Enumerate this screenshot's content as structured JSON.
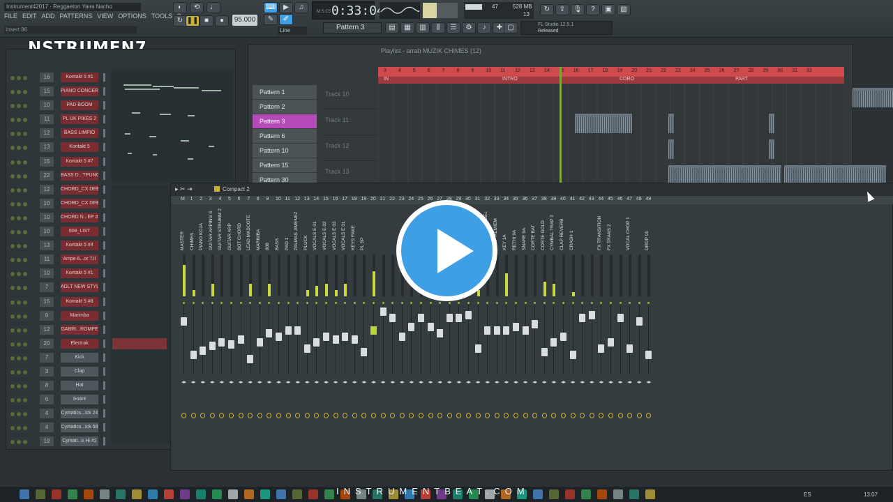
{
  "app": {
    "project_title": "Instrument42017 · Reggaeton Yaira Nacho",
    "menu": [
      "FILE",
      "EDIT",
      "ADD",
      "PATTERNS",
      "VIEW",
      "OPTIONS",
      "TOOLS",
      "?"
    ],
    "hint": "Insert 86",
    "tempo": "95.000",
    "time": "0:33:04",
    "time_unit": "M:S:CS",
    "cpu_poly": "47",
    "ram": "528 MB",
    "voices": "13",
    "pattern": "Pattern 3",
    "snap": "Line",
    "news_title": "FL Studio 12.5.1",
    "news_text": "Released"
  },
  "logo": "NSTRUMEN7",
  "rack": {
    "channels": [
      {
        "num": "16",
        "name": "Kontakt 5 #1",
        "style": "red"
      },
      {
        "num": "15",
        "name": "PIANO CONCERT",
        "style": "red"
      },
      {
        "num": "10",
        "name": "PAD BOOM",
        "style": "red"
      },
      {
        "num": "11",
        "name": "PL UK PIKES 2",
        "style": "red"
      },
      {
        "num": "12",
        "name": "BASS LIMPIO",
        "style": "red"
      },
      {
        "num": "13",
        "name": "Kontakt 5",
        "style": "red"
      },
      {
        "num": "15",
        "name": "Kontakt 5 #7",
        "style": "red"
      },
      {
        "num": "22",
        "name": "BASS D...TPUNO",
        "style": "red"
      },
      {
        "num": "12",
        "name": "CHORD_CX DEEP",
        "style": "red"
      },
      {
        "num": "10",
        "name": "CHORD_CX DEEP",
        "style": "red"
      },
      {
        "num": "10",
        "name": "CHORD N...EP #2",
        "style": "red"
      },
      {
        "num": "10",
        "name": "808_LIST",
        "style": "red"
      },
      {
        "num": "13",
        "name": "Kontakt 5 #4",
        "style": "red"
      },
      {
        "num": "11",
        "name": "Ampe 6...or T.II",
        "style": "red"
      },
      {
        "num": "10",
        "name": "Kontakt 5 #1",
        "style": "red"
      },
      {
        "num": "7",
        "name": "ADLT NEW STYLE",
        "style": "red"
      },
      {
        "num": "15",
        "name": "Kontakt 5 #6",
        "style": "red"
      },
      {
        "num": "9",
        "name": "Marimba",
        "style": "red"
      },
      {
        "num": "12",
        "name": "GABRI...ROMPE",
        "style": "red"
      },
      {
        "num": "20",
        "name": "Electrak",
        "style": "red"
      },
      {
        "num": "7",
        "name": "Kick",
        "style": "grey"
      },
      {
        "num": "3",
        "name": "Clap",
        "style": "grey"
      },
      {
        "num": "8",
        "name": "Hat",
        "style": "grey"
      },
      {
        "num": "6",
        "name": "Snare",
        "style": "grey"
      },
      {
        "num": "4",
        "name": "Cymatics...ick 24",
        "style": "grey"
      },
      {
        "num": "4",
        "name": "Cymatics...ick 58",
        "style": "grey"
      },
      {
        "num": "19",
        "name": "Cymati...k Hi #2",
        "style": "grey"
      }
    ]
  },
  "playlist": {
    "title": "Playlist - arrab MUZIK CHIMES (12)",
    "patterns": [
      "Pattern 1",
      "Pattern 2",
      "Pattern 3",
      "Pattern 6",
      "Pattern 10",
      "Pattern 15",
      "Pattern 30"
    ],
    "active_pattern": 2,
    "tracks": [
      "Track 10",
      "Track 11",
      "Track 12",
      "Track 13"
    ],
    "bar_numbers": [
      "3",
      "4",
      "5",
      "6",
      "7",
      "8",
      "9",
      "10",
      "11",
      "12",
      "13",
      "14",
      "15",
      "16",
      "17",
      "18",
      "19",
      "20",
      "21",
      "22",
      "23",
      "24",
      "25",
      "26",
      "27",
      "28",
      "29",
      "30",
      "31",
      "32"
    ],
    "markers": [
      "IN",
      "INTRO",
      "CORO",
      "PART"
    ]
  },
  "mixer": {
    "title": "Compact 2",
    "tracks": [
      {
        "name": "MASTER",
        "level": 0.75,
        "fader": 0.2
      },
      {
        "name": "CHIMES",
        "level": 0.15,
        "fader": 0.75
      },
      {
        "name": "PIANO KOJA",
        "level": 0.0,
        "fader": 0.68
      },
      {
        "name": "GUITAR ARPING S",
        "level": 0.3,
        "fader": 0.6
      },
      {
        "name": "GUITAR STRUMM 2",
        "level": 0.0,
        "fader": 0.55
      },
      {
        "name": "GUITAR ARP",
        "level": 0.0,
        "fader": 0.58
      },
      {
        "name": "BOT CHORD",
        "level": 0.0,
        "fader": 0.5
      },
      {
        "name": "LEAD MASCOTE",
        "level": 0.3,
        "fader": 0.82
      },
      {
        "name": "MARIMBA",
        "level": 0.0,
        "fader": 0.55
      },
      {
        "name": "808",
        "level": 0.3,
        "fader": 0.4
      },
      {
        "name": "BASS",
        "level": 0.0,
        "fader": 0.45
      },
      {
        "name": "PAD 1",
        "level": 0.0,
        "fader": 0.35
      },
      {
        "name": "PALMAS JIMENEZ",
        "level": 0.0,
        "fader": 0.35
      },
      {
        "name": "PLUCK",
        "level": 0.15,
        "fader": 0.65
      },
      {
        "name": "VOCALS E 01",
        "level": 0.25,
        "fader": 0.55
      },
      {
        "name": "VOCALS E 02",
        "level": 0.3,
        "fader": 0.45
      },
      {
        "name": "VOCALS E 03",
        "level": 0.15,
        "fader": 0.5
      },
      {
        "name": "VOCALS E 01",
        "level": 0.3,
        "fader": 0.45
      },
      {
        "name": "KEYS FAKE",
        "level": 0.0,
        "fader": 0.5
      },
      {
        "name": "PL SP",
        "level": 0.0,
        "fader": 0.7
      },
      {
        "name": "",
        "level": 0.6,
        "fader": 0.35
      },
      {
        "name": "",
        "level": 0.0,
        "fader": 0.05
      },
      {
        "name": "",
        "level": 0.0,
        "fader": 0.15
      },
      {
        "name": "",
        "level": 0.0,
        "fader": 0.45
      },
      {
        "name": "",
        "level": 0.0,
        "fader": 0.3
      },
      {
        "name": "",
        "level": 0.0,
        "fader": 0.15
      },
      {
        "name": "",
        "level": 0.0,
        "fader": 0.3
      },
      {
        "name": "",
        "level": 0.0,
        "fader": 0.4
      },
      {
        "name": "",
        "level": 0.0,
        "fader": 0.15
      },
      {
        "name": "",
        "level": 0.0,
        "fader": 0.15
      },
      {
        "name": "",
        "level": 0.0,
        "fader": 0.1
      },
      {
        "name": "LOOP REVERB",
        "level": 0.15,
        "fader": 0.65
      },
      {
        "name": "DELAY CHOR DEL",
        "level": 0.0,
        "fader": 0.35
      },
      {
        "name": "LOOP REMIEM",
        "level": 0.0,
        "fader": 0.35
      },
      {
        "name": "KEY 1A",
        "level": 0.55,
        "fader": 0.35
      },
      {
        "name": "RETHI 9A",
        "level": 0.0,
        "fader": 0.3
      },
      {
        "name": "SNARE 9A",
        "level": 0.0,
        "fader": 0.35
      },
      {
        "name": "CORTE BAT",
        "level": 0.0,
        "fader": 0.25
      },
      {
        "name": "CORTE GOLD",
        "level": 0.35,
        "fader": 0.7
      },
      {
        "name": "CYMBAL TRAP 2",
        "level": 0.3,
        "fader": 0.55
      },
      {
        "name": "CLAP REVERB",
        "level": 0.0,
        "fader": 0.45
      },
      {
        "name": "CRASH 1",
        "level": 0.1,
        "fader": 0.75
      },
      {
        "name": "",
        "level": 0.0,
        "fader": 0.15
      },
      {
        "name": "",
        "level": 0.0,
        "fader": 0.1
      },
      {
        "name": "FX TRANSITION",
        "level": 0.0,
        "fader": 0.65
      },
      {
        "name": "FX TRANS 2",
        "level": 0.0,
        "fader": 0.55
      },
      {
        "name": "",
        "level": 0.0,
        "fader": 0.15
      },
      {
        "name": "VOCAL CHOP 1",
        "level": 0.0,
        "fader": 0.65
      },
      {
        "name": "",
        "level": 0.0,
        "fader": 0.2
      },
      {
        "name": "DROP 01",
        "level": 0.0,
        "fader": 0.75
      }
    ]
  },
  "site": "INSTRUMENTBEAT.COM",
  "tray": {
    "lang": "ES",
    "clock": "13:07"
  },
  "colors": {
    "accent": "#3ea0e3",
    "clip_red": "#cf4a4d",
    "pattern_active": "#b54ab8",
    "meter": "#c9d93b"
  }
}
